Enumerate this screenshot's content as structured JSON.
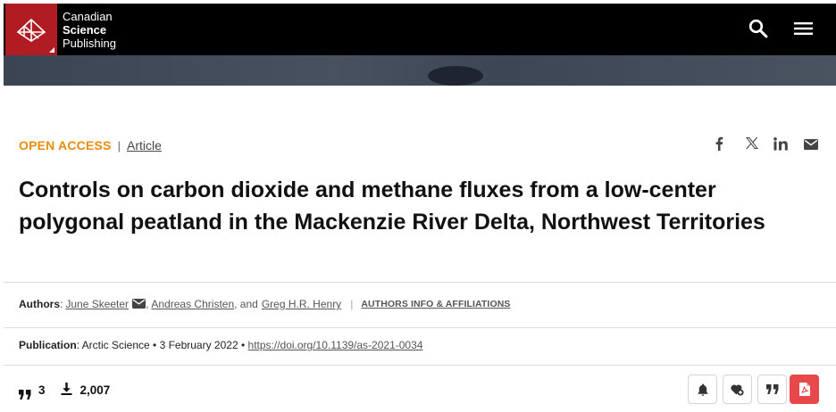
{
  "header": {
    "brand_line1": "Canadian",
    "brand_line2": "Science",
    "brand_line3": "Publishing",
    "search_icon": "search-icon",
    "menu_icon": "hamburger-menu-icon",
    "brand_color": "#b01c21"
  },
  "article": {
    "access_label": "OPEN ACCESS",
    "separator": "|",
    "type_label": "Article",
    "title": "Controls on carbon dioxide and methane fluxes from a low-center polygonal peatland in the Mackenzie River Delta, Northwest Territories",
    "accent_color": "#e98c0b"
  },
  "share": {
    "facebook": "f",
    "x": "𝕏",
    "linkedin": "in",
    "email_icon": "email-icon"
  },
  "authors": {
    "label": "Authors",
    "colon": ":",
    "author1": "June Skeeter",
    "comma1": ",",
    "author2": "Andreas Christen",
    "and_text": ", and",
    "author3": "Greg H.R. Henry",
    "bar": "|",
    "info_link": "AUTHORS INFO & AFFILIATIONS"
  },
  "publication": {
    "label": "Publication",
    "journal": ": Arctic Science • 3 February 2022 •",
    "doi": "https://doi.org/10.1139/as-2021-0034"
  },
  "metrics": {
    "citations": "3",
    "downloads": "2,007",
    "citation_icon": "quote-icon",
    "download_icon": "download-icon"
  },
  "actions": [
    {
      "name": "alert-button",
      "icon": "bell-icon"
    },
    {
      "name": "favorite-button",
      "icon": "heart-add-icon"
    },
    {
      "name": "cite-button",
      "icon": "quote-icon"
    },
    {
      "name": "pdf-button",
      "icon": "pdf-icon",
      "color": "#e8484a"
    }
  ]
}
